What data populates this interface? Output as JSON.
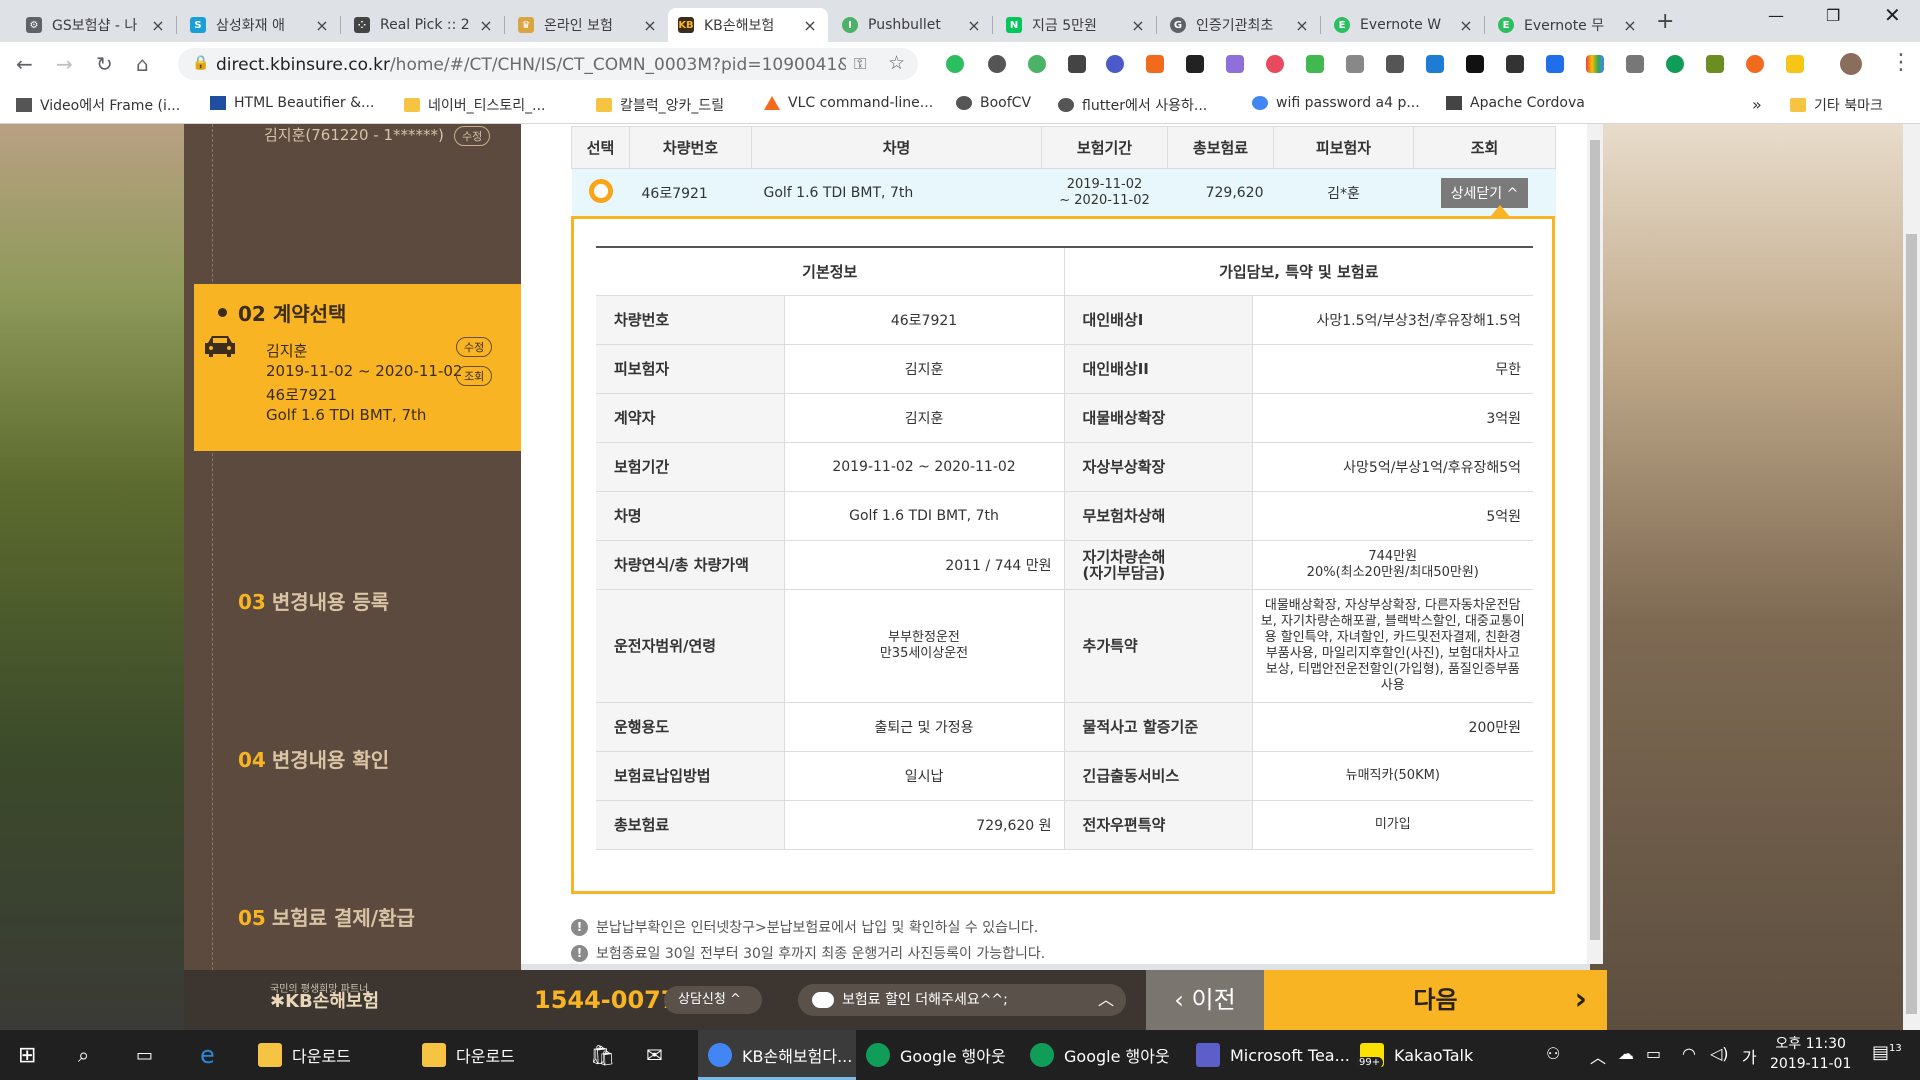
{
  "browser": {
    "tabs": [
      {
        "title": "GS보험샵 - 나",
        "icon_color": "#5f6368",
        "icon": "gear-icon"
      },
      {
        "title": "삼성화재 애",
        "icon_color": "#1a9fd9",
        "icon": "samsung-icon"
      },
      {
        "title": "Real Pick :: 2",
        "icon_color": "#444444",
        "icon": "dots-icon"
      },
      {
        "title": "온라인 보험",
        "icon_color": "#d9a441",
        "icon": "logo-icon"
      },
      {
        "title": "KB손해보험",
        "icon_color": "#f8b423",
        "icon": "kb-icon",
        "active": true
      },
      {
        "title": "Pushbullet",
        "icon_color": "#4ab367",
        "icon": "pushbullet-icon"
      },
      {
        "title": "지금 5만원",
        "icon_color": "#03c75a",
        "icon": "naver-icon"
      },
      {
        "title": "인증기관최초",
        "icon_color": "#5f6368",
        "icon": "cert-icon"
      },
      {
        "title": "Evernote W",
        "icon_color": "#2dbe60",
        "icon": "evernote-icon"
      },
      {
        "title": "Evernote 무",
        "icon_color": "#2dbe60",
        "icon": "evernote-icon"
      }
    ],
    "url_host": "direct.kbinsure.co.kr",
    "url_path": "/home/#/CT/CHN/IS/CT_COMN_0003M?pid=1090041&c...",
    "bookmarks": [
      {
        "label": "Video에서 Frame (i...",
        "icon": "dots-icon"
      },
      {
        "label": "HTML Beautifier &...",
        "icon": "tools-icon"
      },
      {
        "label": "네이버_티스토리_...",
        "icon": "folder-icon"
      },
      {
        "label": "칼블럭_앙카_드릴",
        "icon": "folder-icon"
      },
      {
        "label": "VLC command-line...",
        "icon": "vlc-icon"
      },
      {
        "label": "BoofCV",
        "icon": "globe-icon"
      },
      {
        "label": "flutter에서 사용하...",
        "icon": "globe-icon"
      },
      {
        "label": "wifi password a4 p...",
        "icon": "google-icon"
      },
      {
        "label": "Apache Cordova",
        "icon": "cordova-icon"
      }
    ],
    "bookmarks_more": "»",
    "other_bookmarks": "기타 북마크"
  },
  "sidebar": {
    "prev_name": "김지훈(761220 - 1******)",
    "prev_edit": "수정",
    "active_step": {
      "num": "02",
      "title": "계약선택",
      "lines": [
        "김지훈",
        "2019-11-02 ~ 2020-11-02",
        "46로7921",
        "Golf 1.6 TDI BMT, 7th"
      ],
      "edit": "수정",
      "view": "조회"
    },
    "steps": [
      {
        "num": "03",
        "title": "변경내용 등록"
      },
      {
        "num": "04",
        "title": "변경내용 확인"
      },
      {
        "num": "05",
        "title": "보험료 결제/환급"
      }
    ]
  },
  "summary": {
    "headers": [
      "선택",
      "차량번호",
      "차명",
      "보험기간",
      "총보험료",
      "피보험자",
      "조회"
    ],
    "row": {
      "car_no": "46로7921",
      "car_name": "Golf 1.6 TDI BMT, 7th",
      "period_1": "2019-11-02",
      "period_2": "~ 2020-11-02",
      "premium": "729,620",
      "insured": "김*훈",
      "detail_button": "상세닫기 ^"
    }
  },
  "detail": {
    "left_header": "기본정보",
    "right_header": "가입담보, 특약 및 보험료",
    "rows": [
      {
        "k1": "차량번호",
        "v1": "46로7921",
        "k2": "대인배상I",
        "v2": "사망1.5억/부상3천/후유장해1.5억"
      },
      {
        "k1": "피보험자",
        "v1": "김지훈",
        "k2": "대인배상II",
        "v2": "무한"
      },
      {
        "k1": "계약자",
        "v1": "김지훈",
        "k2": "대물배상확장",
        "v2": "3억원"
      },
      {
        "k1": "보험기간",
        "v1": "2019-11-02 ~ 2020-11-02",
        "k2": "자상부상확장",
        "v2": "사망5억/부상1억/후유장해5억"
      },
      {
        "k1": "차명",
        "v1": "Golf 1.6 TDI BMT, 7th",
        "k2": "무보험차상해",
        "v2": "5억원"
      }
    ],
    "row6": {
      "k1": "차량연식/총 차량가액",
      "v1": "2011 / 744 만원",
      "k2a": "자기차량손해",
      "k2b": "(자기부담금)",
      "v2a": "744만원",
      "v2b": "20%(최소20만원/최대50만원)"
    },
    "row7": {
      "k1": "운전자범위/연령",
      "v1a": "부부한정운전",
      "v1b": "만35세이상운전",
      "k2": "추가특약",
      "v2": "대물배상확장, 자상부상확장, 다른자동차운전담보, 자기차량손해포괄, 블랙박스할인, 대중교통이용 할인특약, 자녀할인, 카드및전자결제, 친환경부품사용, 마일리지후할인(사진), 보험대차사고보상, 티맵안전운전할인(가입형), 품질인증부품사용"
    },
    "rows_tail": [
      {
        "k1": "운행용도",
        "v1": "출퇴근 및 가정용",
        "k2": "물적사고 할증기준",
        "v2": "200만원"
      },
      {
        "k1": "보험료납입방법",
        "v1": "일시납",
        "k2": "긴급출동서비스",
        "v2": "뉴매직카(50KM)"
      },
      {
        "k1": "총보험료",
        "v1": "729,620 원",
        "k2": "전자우편특약",
        "v2": "미가입"
      }
    ]
  },
  "notes": [
    "분납납부확인은 인터넷창구>분납보험료에서 납입 및 확인하실 수 있습니다.",
    "보험종료일 30일 전부터 30일 후까지 최종 운행거리 사진등록이 가능합니다."
  ],
  "bottom": {
    "tagline": "국민의 평생희망 파트너",
    "brand": "KB손해보험",
    "phone": "1544-0077",
    "consult": "상담신청 ^",
    "chat": "보험료 할인 더해주세요^^;",
    "prev": "이전",
    "next": "다음"
  },
  "taskbar": {
    "items": [
      {
        "label": "다운로드",
        "icon_color": "#f6c343"
      },
      {
        "label": "다운로드",
        "icon_color": "#f6c343"
      },
      {
        "label": "KB손해보험다...",
        "icon_color": "#4285f4",
        "active": true
      },
      {
        "label": "Google 행아웃",
        "icon_color": "#0f9d58"
      },
      {
        "label": "Google 행아웃",
        "icon_color": "#0f9d58"
      },
      {
        "label": "Microsoft Tea...",
        "icon_color": "#5b5fc7"
      },
      {
        "label": "KakaoTalk",
        "icon_color": "#fae100"
      }
    ],
    "kakao_badge": "99+",
    "ime": "가",
    "time": "오후 11:30",
    "date": "2019-11-01",
    "notif_count": "13"
  }
}
